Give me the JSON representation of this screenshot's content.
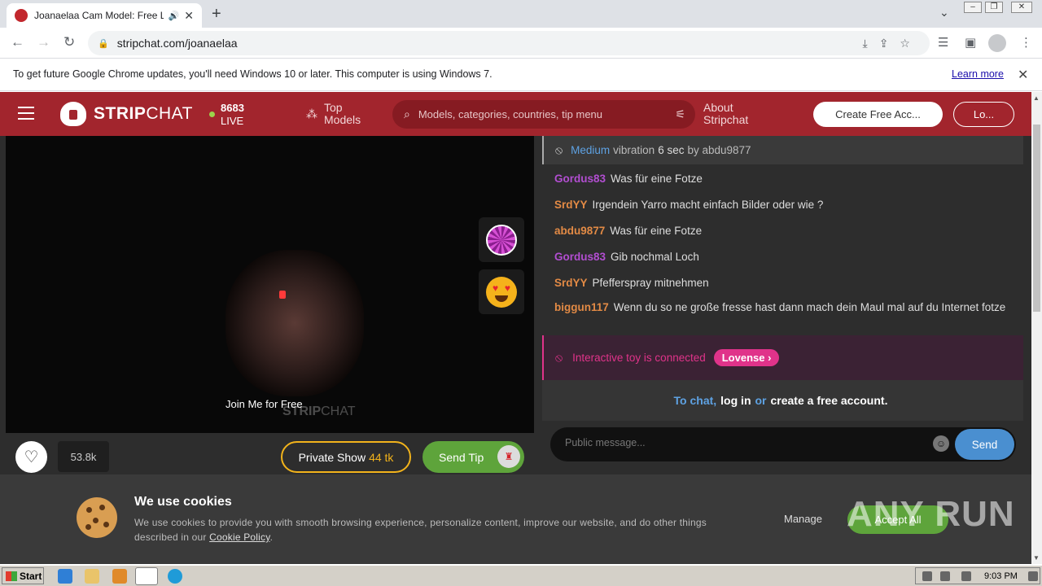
{
  "browser": {
    "tab_title": "Joanaelaa Cam Model: Free Live",
    "url": "stripchat.com/joanaelaa",
    "infobar_message": "To get future Google Chrome updates, you'll need Windows 10 or later. This computer is using Windows 7.",
    "infobar_link": "Learn more"
  },
  "header": {
    "logo_bold": "STRIP",
    "logo_rest": "CHAT",
    "live_count": "8683",
    "live_label": "LIVE",
    "top_models": [
      "Top",
      "Models"
    ],
    "search_placeholder": "Models, categories, countries, tip menu",
    "about": [
      "About",
      "Stripchat"
    ],
    "create_account": "Create Free Acc...",
    "login": "Lo..."
  },
  "stream": {
    "overlay_text": "Join Me for Free",
    "watermark_bold": "STRIP",
    "watermark_rest": "CHAT",
    "viewers": "53.8k",
    "private_show_label": "Private Show",
    "private_show_price": "44 tk",
    "send_tip": "Send Tip"
  },
  "chat": {
    "vibration": {
      "level": "Medium",
      "word1": "vibration",
      "duration": "6 sec",
      "word2": "by",
      "user": "abdu9877"
    },
    "messages": [
      {
        "user": "Gordus83",
        "color": "purple",
        "text": "Was für eine Fotze"
      },
      {
        "user": "SrdYY",
        "color": "orange",
        "text": "Irgendein Yarro macht einfach Bilder oder wie ?"
      },
      {
        "user": "abdu9877",
        "color": "orange",
        "text": "Was für eine Fotze"
      },
      {
        "user": "Gordus83",
        "color": "purple",
        "text": "Gib nochmal Loch"
      },
      {
        "user": "SrdYY",
        "color": "orange",
        "text": "Pfefferspray mitnehmen"
      },
      {
        "user": "biggun117",
        "color": "orange",
        "text": "Wenn du so ne große fresse hast dann mach dein Maul mal auf du Internet fotze"
      }
    ],
    "toy_text": "Interactive toy is connected",
    "toy_brand": "Lovense",
    "login_prompt": {
      "a": "To chat,",
      "b": "log in",
      "c": "or",
      "d": "create a free account."
    },
    "input_placeholder": "Public message...",
    "send": "Send"
  },
  "cookies": {
    "title": "We use cookies",
    "text": "We use cookies to provide you with smooth browsing experience, personalize content, improve our website, and do other things described in our",
    "policy_link": "Cookie Policy",
    "manage": "Manage",
    "accept": "Accept All"
  },
  "overlay_watermark": "ANY RUN",
  "taskbar": {
    "start": "Start",
    "clock": "9:03 PM"
  },
  "colors": {
    "brand_red": "#a2252d",
    "tip_green": "#5ea43b",
    "private_gold": "#f2b31b",
    "toy_pink": "#e0338a",
    "link_blue": "#5ea2e3"
  }
}
